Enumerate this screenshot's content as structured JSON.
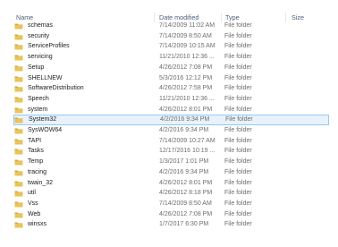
{
  "columns": {
    "name": "Name",
    "date_modified": "Date modified",
    "type": "Type",
    "size": "Size"
  },
  "rows": [
    {
      "name": "schemas",
      "date": "7/14/2009 11:02 AM",
      "type": "File folder"
    },
    {
      "name": "security",
      "date": "7/14/2009 8:50 AM",
      "type": "File folder"
    },
    {
      "name": "ServiceProfiles",
      "date": "7/14/2009 10:15 AM",
      "type": "File folder"
    },
    {
      "name": "servicing",
      "date": "11/21/2010 12:36 ...",
      "type": "File folder"
    },
    {
      "name": "Setup",
      "date": "4/26/2012 7:08 PM",
      "type": "File folder"
    },
    {
      "name": "SHELLNEW",
      "date": "5/3/2016 12:12 PM",
      "type": "File folder"
    },
    {
      "name": "SoftwareDistribution",
      "date": "4/26/2012 7:58 PM",
      "type": "File folder"
    },
    {
      "name": "Speech",
      "date": "11/21/2010 12:36 ...",
      "type": "File folder"
    },
    {
      "name": "system",
      "date": "4/26/2012 8:01 PM",
      "type": "File folder"
    },
    {
      "name": "System32",
      "date": "4/2/2016 9:34 PM",
      "type": "File folder",
      "selected": true
    },
    {
      "name": "SysWOW64",
      "date": "4/2/2016 9:34 PM",
      "type": "File folder"
    },
    {
      "name": "TAPI",
      "date": "7/14/2009 10:27 AM",
      "type": "File folder"
    },
    {
      "name": "Tasks",
      "date": "12/17/2016 10:19 ...",
      "type": "File folder"
    },
    {
      "name": "Temp",
      "date": "1/3/2017 1:01 PM",
      "type": "File folder"
    },
    {
      "name": "tracing",
      "date": "4/2/2016 9:34 PM",
      "type": "File folder"
    },
    {
      "name": "twain_32",
      "date": "4/26/2012 8:01 PM",
      "type": "File folder"
    },
    {
      "name": "util",
      "date": "4/26/2012 8:18 PM",
      "type": "File folder"
    },
    {
      "name": "Vss",
      "date": "7/14/2009 8:50 AM",
      "type": "File folder"
    },
    {
      "name": "Web",
      "date": "4/26/2012 7:08 PM",
      "type": "File folder"
    },
    {
      "name": "winsxs",
      "date": "1/7/2017 6:30 PM",
      "type": "File folder"
    }
  ],
  "icons": {
    "folder": "folder-icon"
  },
  "colors": {
    "folder_body": "#e8c45a",
    "folder_tab": "#d7a93b",
    "selection_fill": "#e7f2fd",
    "selection_border": "#99c7f0",
    "header_text": "#4c607a"
  }
}
